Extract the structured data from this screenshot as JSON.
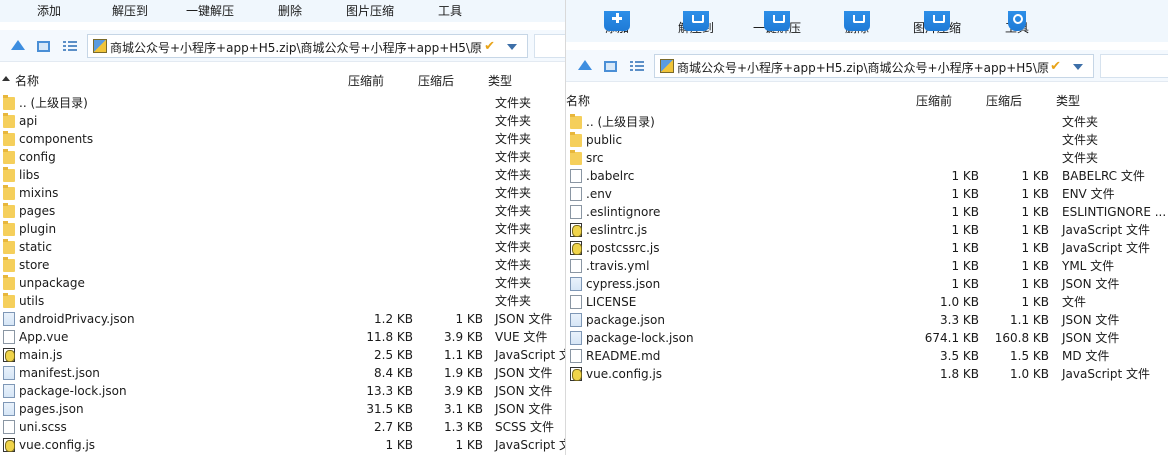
{
  "left": {
    "toolbar": [
      {
        "label": "添加",
        "icon": "add-icon"
      },
      {
        "label": "解压到",
        "icon": "extract-icon"
      },
      {
        "label": "一键解压",
        "icon": "one-click-extract-icon"
      },
      {
        "label": "删除",
        "icon": "delete-icon"
      },
      {
        "label": "图片压缩",
        "icon": "image-compress-icon"
      },
      {
        "label": "工具",
        "icon": "tools-icon"
      }
    ],
    "path": "商城公众号+小程序+app+H5.zip\\商城公众号+小程序+app+H5\\原",
    "columns": {
      "name": "名称",
      "compressed_before": "压缩前",
      "compressed_after": "压缩后",
      "type": "类型"
    },
    "files": [
      {
        "name": ".. (上级目录)",
        "before": "",
        "after": "",
        "type": "文件夹",
        "kind": "folder"
      },
      {
        "name": "api",
        "before": "",
        "after": "",
        "type": "文件夹",
        "kind": "folder"
      },
      {
        "name": "components",
        "before": "",
        "after": "",
        "type": "文件夹",
        "kind": "folder"
      },
      {
        "name": "config",
        "before": "",
        "after": "",
        "type": "文件夹",
        "kind": "folder"
      },
      {
        "name": "libs",
        "before": "",
        "after": "",
        "type": "文件夹",
        "kind": "folder"
      },
      {
        "name": "mixins",
        "before": "",
        "after": "",
        "type": "文件夹",
        "kind": "folder"
      },
      {
        "name": "pages",
        "before": "",
        "after": "",
        "type": "文件夹",
        "kind": "folder"
      },
      {
        "name": "plugin",
        "before": "",
        "after": "",
        "type": "文件夹",
        "kind": "folder"
      },
      {
        "name": "static",
        "before": "",
        "after": "",
        "type": "文件夹",
        "kind": "folder"
      },
      {
        "name": "store",
        "before": "",
        "after": "",
        "type": "文件夹",
        "kind": "folder"
      },
      {
        "name": "unpackage",
        "before": "",
        "after": "",
        "type": "文件夹",
        "kind": "folder"
      },
      {
        "name": "utils",
        "before": "",
        "after": "",
        "type": "文件夹",
        "kind": "folder"
      },
      {
        "name": "androidPrivacy.json",
        "before": "1.2 KB",
        "after": "1 KB",
        "type": "JSON 文件",
        "kind": "json"
      },
      {
        "name": "App.vue",
        "before": "11.8 KB",
        "after": "3.9 KB",
        "type": "VUE 文件",
        "kind": "file"
      },
      {
        "name": "main.js",
        "before": "2.5 KB",
        "after": "1.1 KB",
        "type": "JavaScript 文",
        "kind": "js"
      },
      {
        "name": "manifest.json",
        "before": "8.4 KB",
        "after": "1.9 KB",
        "type": "JSON 文件",
        "kind": "json"
      },
      {
        "name": "package-lock.json",
        "before": "13.3 KB",
        "after": "3.9 KB",
        "type": "JSON 文件",
        "kind": "json"
      },
      {
        "name": "pages.json",
        "before": "31.5 KB",
        "after": "3.1 KB",
        "type": "JSON 文件",
        "kind": "json"
      },
      {
        "name": "uni.scss",
        "before": "2.7 KB",
        "after": "1.3 KB",
        "type": "SCSS 文件",
        "kind": "file"
      },
      {
        "name": "vue.config.js",
        "before": "1 KB",
        "after": "1 KB",
        "type": "JavaScript 文",
        "kind": "js"
      }
    ]
  },
  "right": {
    "toolbar": [
      {
        "label": "添加",
        "icon": "add-icon"
      },
      {
        "label": "解压到",
        "icon": "extract-icon"
      },
      {
        "label": "一键解压",
        "icon": "one-click-extract-icon"
      },
      {
        "label": "删除",
        "icon": "delete-icon"
      },
      {
        "label": "图片压缩",
        "icon": "image-compress-icon"
      },
      {
        "label": "工具",
        "icon": "tools-icon"
      }
    ],
    "path": "商城公众号+小程序+app+H5.zip\\商城公众号+小程序+app+H5\\原",
    "columns": {
      "name": "名称",
      "compressed_before": "压缩前",
      "compressed_after": "压缩后",
      "type": "类型"
    },
    "files": [
      {
        "name": ".. (上级目录)",
        "before": "",
        "after": "",
        "type": "文件夹",
        "kind": "folder"
      },
      {
        "name": "public",
        "before": "",
        "after": "",
        "type": "文件夹",
        "kind": "folder"
      },
      {
        "name": "src",
        "before": "",
        "after": "",
        "type": "文件夹",
        "kind": "folder"
      },
      {
        "name": ".babelrc",
        "before": "1 KB",
        "after": "1 KB",
        "type": "BABELRC 文件",
        "kind": "file"
      },
      {
        "name": ".env",
        "before": "1 KB",
        "after": "1 KB",
        "type": "ENV 文件",
        "kind": "file"
      },
      {
        "name": ".eslintignore",
        "before": "1 KB",
        "after": "1 KB",
        "type": "ESLINTIGNORE ...",
        "kind": "file"
      },
      {
        "name": ".eslintrc.js",
        "before": "1 KB",
        "after": "1 KB",
        "type": "JavaScript 文件",
        "kind": "js"
      },
      {
        "name": ".postcssrc.js",
        "before": "1 KB",
        "after": "1 KB",
        "type": "JavaScript 文件",
        "kind": "js"
      },
      {
        "name": ".travis.yml",
        "before": "1 KB",
        "after": "1 KB",
        "type": "YML 文件",
        "kind": "file"
      },
      {
        "name": "cypress.json",
        "before": "1 KB",
        "after": "1 KB",
        "type": "JSON 文件",
        "kind": "json"
      },
      {
        "name": "LICENSE",
        "before": "1.0 KB",
        "after": "1 KB",
        "type": "文件",
        "kind": "file"
      },
      {
        "name": "package.json",
        "before": "3.3 KB",
        "after": "1.1 KB",
        "type": "JSON 文件",
        "kind": "json"
      },
      {
        "name": "package-lock.json",
        "before": "674.1 KB",
        "after": "160.8 KB",
        "type": "JSON 文件",
        "kind": "json"
      },
      {
        "name": "README.md",
        "before": "3.5 KB",
        "after": "1.5 KB",
        "type": "MD 文件",
        "kind": "file"
      },
      {
        "name": "vue.config.js",
        "before": "1.8 KB",
        "after": "1.0 KB",
        "type": "JavaScript 文件",
        "kind": "js"
      }
    ]
  },
  "colors": {
    "toolbar_bg": "#f0f7fd",
    "accent": "#1f7bd6",
    "folder": "#f5cf5b",
    "check": "#e8a317"
  }
}
